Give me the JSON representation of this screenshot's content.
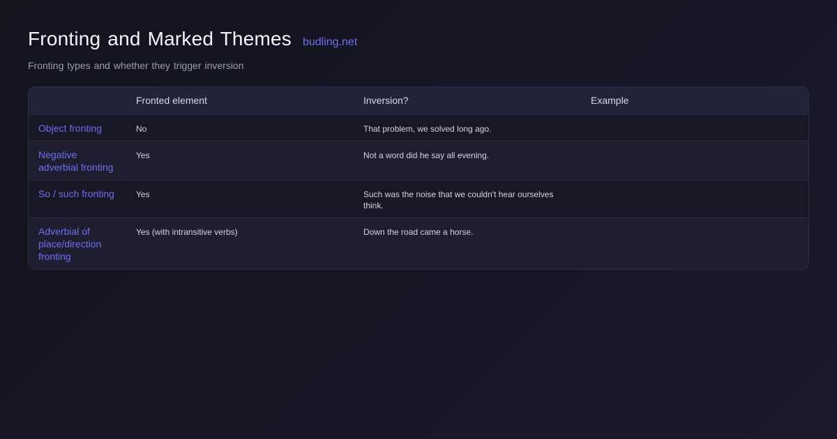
{
  "header": {
    "title": "Fronting and Marked Themes",
    "site": "budling.net",
    "subtitle": "Fronting types and whether they trigger inversion"
  },
  "table": {
    "columns": [
      "",
      "Fronted element",
      "Inversion?",
      "Example"
    ],
    "rows": [
      {
        "label": "Object fronting",
        "fronted": "No",
        "inversion": "That problem, we solved long ago.",
        "example": ""
      },
      {
        "label": "Negative adverbial fronting",
        "fronted": "Yes",
        "inversion": "Not a word did he say all evening.",
        "example": ""
      },
      {
        "label": "So / such fronting",
        "fronted": "Yes",
        "inversion": "Such was the noise that we couldn't hear ourselves think.",
        "example": ""
      },
      {
        "label": "Adverbial of place/direction fronting",
        "fronted": "Yes (with intransitive verbs)",
        "inversion": "Down the road came a horse.",
        "example": ""
      }
    ]
  }
}
